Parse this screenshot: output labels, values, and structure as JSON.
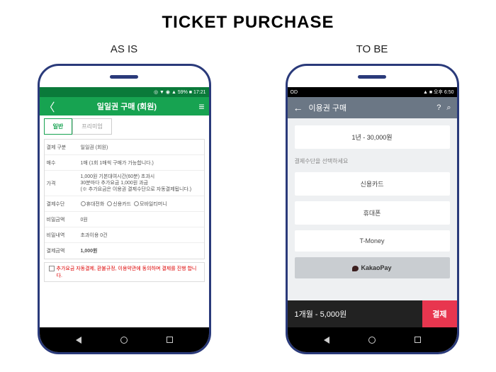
{
  "title": "TICKET PURCHASE",
  "asis": {
    "label": "AS IS",
    "status": "◎ ▼ ◉ ▲ 59% ■ 17:21",
    "header": {
      "title": "일일권 구매 (회원)"
    },
    "tabs": {
      "active": "일반",
      "inactive": "프리미엄"
    },
    "rows": {
      "r1": {
        "label": "결제 구분",
        "value": "일일권 (회원)"
      },
      "r2": {
        "label": "매수",
        "value": "1매  (1회 1매씩 구매가 가능합니다.)"
      },
      "r3": {
        "label": "가격",
        "value": "1,000원 기본대여시간(60분) 초과시\n30분마다 추가요금 1,000원 과금\n(※ 추가요금은 이용권 결제수단으로 자동결제됩니다.)"
      },
      "r4": {
        "label": "결제수단",
        "options": [
          "휴대전화",
          "신용카드",
          "모바일티머니"
        ]
      },
      "r5": {
        "label": "비밀금액",
        "value": "0원"
      },
      "r6": {
        "label": "비밀내역",
        "value": "초과이용 0건"
      },
      "r7": {
        "label": "결제금액",
        "value": "1,000원"
      }
    },
    "consent": "추가요금 자동결제, 환불규정, 이용약관에 동의하며 결제를 진행 합니다."
  },
  "tobe": {
    "label": "TO BE",
    "status": {
      "left": "OD",
      "right": "▲ ■ 오후 6:50"
    },
    "header": {
      "title": "이용권 구매"
    },
    "selection": "1년   -   30,000원",
    "selectLabel": "결제수단을 선택하세요",
    "methods": {
      "m1": "신용카드",
      "m2": "휴대폰",
      "m3": "T-Money",
      "m4": "KakaoPay"
    },
    "bottom": {
      "info": "1개월 - 5,000원",
      "pay": "결제"
    }
  }
}
